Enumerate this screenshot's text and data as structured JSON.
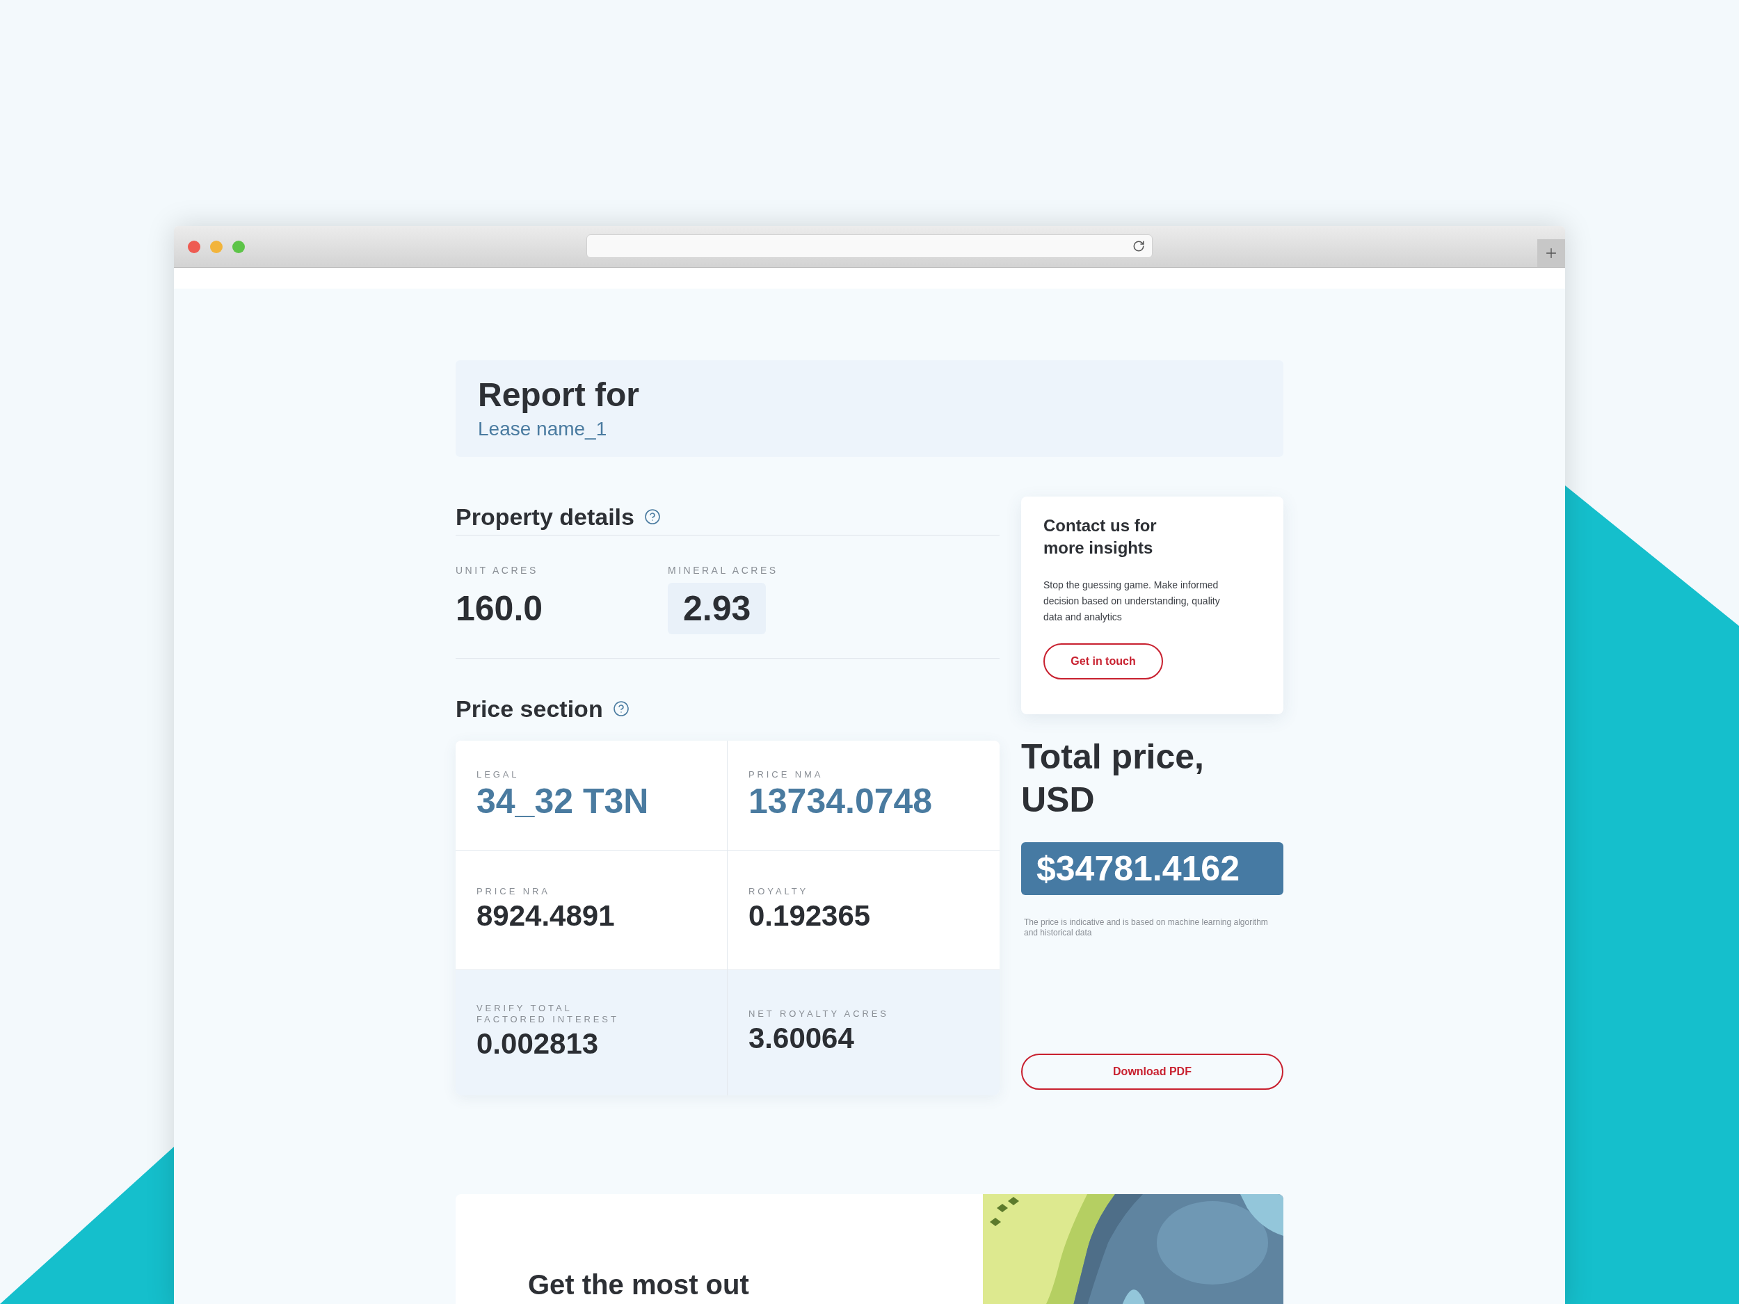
{
  "report": {
    "title": "Report for",
    "lease_name": "Lease name_1"
  },
  "property_details": {
    "title": "Property details",
    "fields": [
      {
        "label": "UNIT ACRES",
        "value": "160.0",
        "highlighted": false
      },
      {
        "label": "MINERAL ACRES",
        "value": "2.93",
        "highlighted": true
      }
    ]
  },
  "price_section": {
    "title": "Price section",
    "cells": [
      {
        "label": "LEGAL",
        "value": "34_32 T3N",
        "accent": true,
        "shaded": false
      },
      {
        "label": "PRICE NMA",
        "value": "13734.0748",
        "accent": true,
        "shaded": false
      },
      {
        "label": "PRICE NRA",
        "value": "8924.4891",
        "accent": false,
        "shaded": false
      },
      {
        "label": "ROYALTY",
        "value": "0.192365",
        "accent": false,
        "shaded": false
      },
      {
        "label": "VERIFY TOTAL FACTORED INTEREST",
        "value": "0.002813",
        "accent": false,
        "shaded": true
      },
      {
        "label": "NET ROYALTY ACRES",
        "value": "3.60064",
        "accent": false,
        "shaded": true
      }
    ]
  },
  "contact": {
    "title": "Contact us for more insights",
    "body": "Stop the guessing game. Make informed decision based on understanding, quality data and analytics",
    "button": "Get in touch"
  },
  "total": {
    "title": "Total price, USD",
    "amount": "$34781.4162",
    "note": "The price is indicative and is based on machine learning algorithm and historical data",
    "download_button": "Download PDF"
  },
  "promo": {
    "title": "Get the most out"
  }
}
